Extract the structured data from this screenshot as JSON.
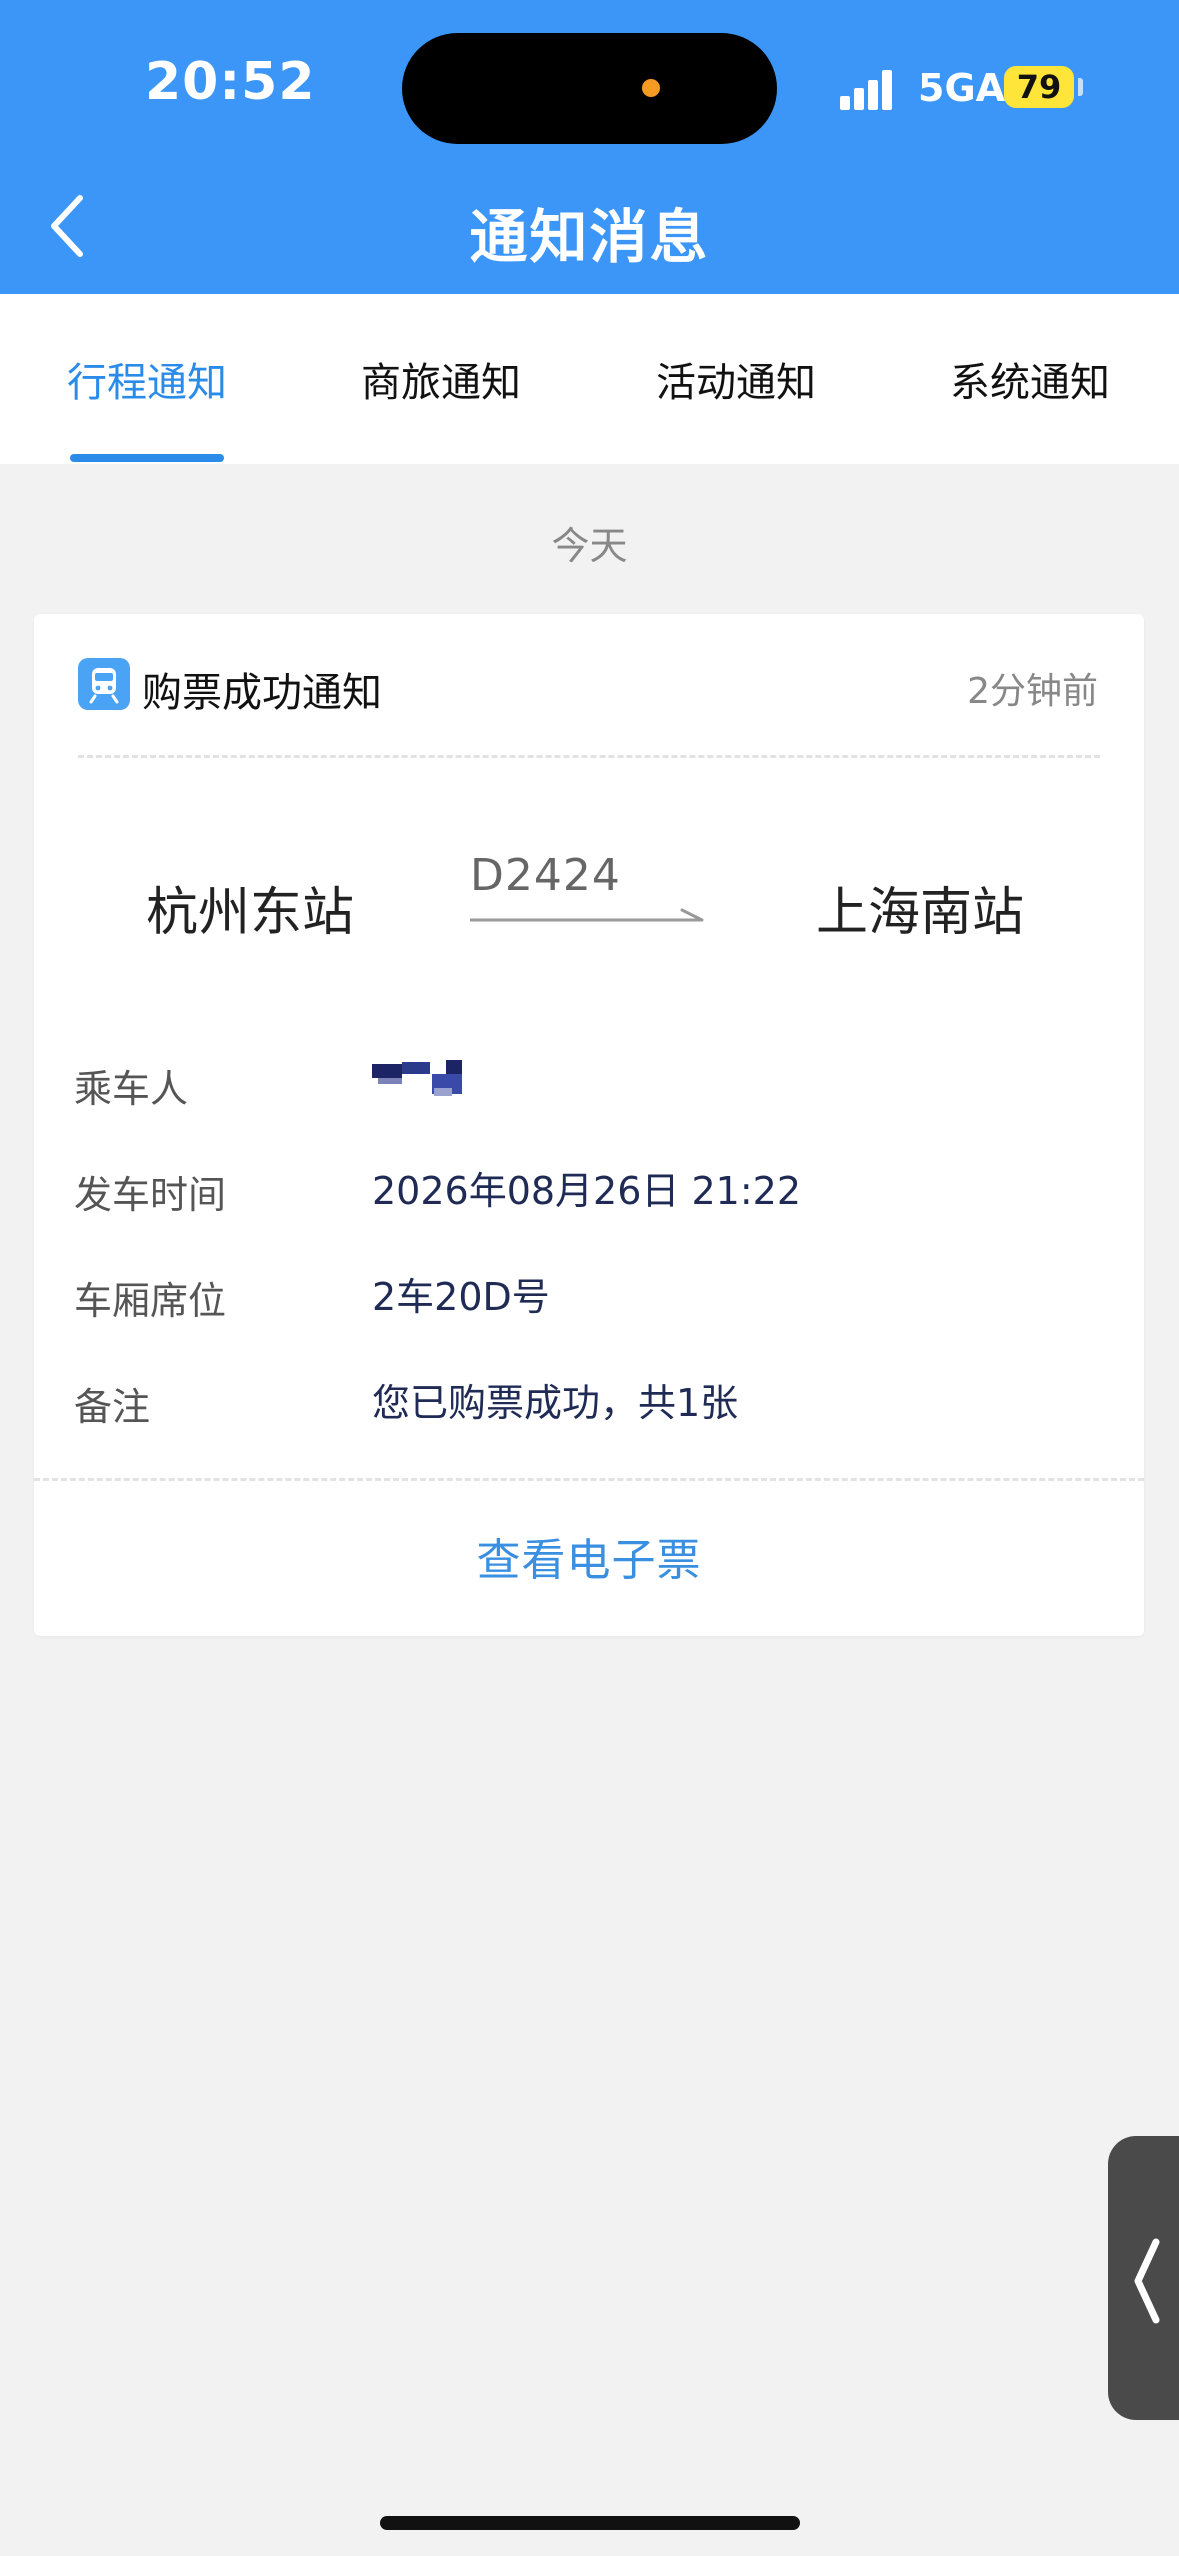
{
  "status_bar": {
    "time": "20:52",
    "network": "5GA",
    "battery": "79"
  },
  "header": {
    "title": "通知消息"
  },
  "tabs": [
    {
      "label": "行程通知",
      "active": true
    },
    {
      "label": "商旅通知",
      "active": false
    },
    {
      "label": "活动通知",
      "active": false
    },
    {
      "label": "系统通知",
      "active": false
    }
  ],
  "day_label": "今天",
  "card": {
    "title": "购票成功通知",
    "time_ago": "2分钟前",
    "from_station": "杭州东站",
    "train_number": "D2424",
    "to_station": "上海南站",
    "rows": [
      {
        "label": "乘车人",
        "value": ""
      },
      {
        "label": "发车时间",
        "value": "2026年08月26日 21:22"
      },
      {
        "label": "车厢席位",
        "value": "2车20D号"
      },
      {
        "label": "备注",
        "value": "您已购票成功，共1张"
      }
    ],
    "action": "查看电子票"
  },
  "colors": {
    "header": "#3b96f7",
    "accent": "#2b8be8",
    "link": "#3a8fe0",
    "value_text": "#1f2a55"
  },
  "icons": [
    "back-chevron-icon",
    "train-icon",
    "arrow-right-icon",
    "side-chevron-icon"
  ]
}
